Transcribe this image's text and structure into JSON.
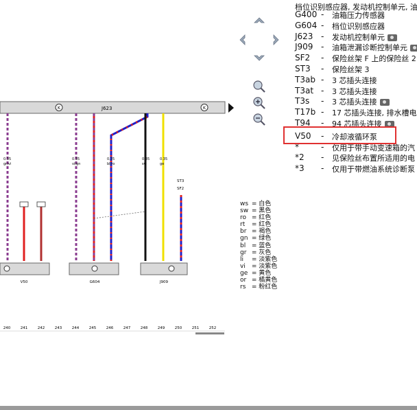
{
  "header_partial": "档位识别感应器, 发动机控制单元, 油",
  "components": [
    {
      "code": "G400",
      "desc": "油箱压力传感器",
      "cam": false
    },
    {
      "code": "G604",
      "desc": "档位识别感应器",
      "cam": false
    },
    {
      "code": "J623",
      "desc": "发动机控制单元",
      "cam": true
    },
    {
      "code": "J909",
      "desc": "油箱泄漏诊断控制单元",
      "cam": true
    },
    {
      "code": "SF2",
      "desc": "保险丝架 F 上的保险丝 2",
      "cam": false
    },
    {
      "code": "ST3",
      "desc": "保险丝架 3",
      "cam": false
    },
    {
      "code": "T3ab",
      "desc": "3 芯插头连接",
      "cam": false
    },
    {
      "code": "T3at",
      "desc": "3 芯插头连接",
      "cam": false
    },
    {
      "code": "T3s",
      "desc": "3 芯插头连接",
      "cam": true
    },
    {
      "code": "T17b",
      "desc": "17 芯插头连接, 排水槽电",
      "cam": false
    },
    {
      "code": "T94",
      "desc": "94 芯插头连接",
      "cam": true
    },
    {
      "code": "V50",
      "desc": "冷却液循环泵",
      "cam": false
    },
    {
      "code": "*",
      "desc": "仅用于带手动变速箱的汽",
      "cam": false
    },
    {
      "code": "*2",
      "desc": "见保险丝布置所适用的电",
      "cam": false
    },
    {
      "code": "*3",
      "desc": "仅用于带燃油系统诊断泵",
      "cam": false
    }
  ],
  "highlighted_code": "V50",
  "color_legend": [
    {
      "abbr": "ws",
      "name": "白色"
    },
    {
      "abbr": "sw",
      "name": "黑色"
    },
    {
      "abbr": "ro",
      "name": "红色"
    },
    {
      "abbr": "rt",
      "name": "红色"
    },
    {
      "abbr": "br",
      "name": "褐色"
    },
    {
      "abbr": "gn",
      "name": "绿色"
    },
    {
      "abbr": "bl",
      "name": "蓝色"
    },
    {
      "abbr": "gr",
      "name": "灰色"
    },
    {
      "abbr": "li",
      "name": "淡紫色"
    },
    {
      "abbr": "vi",
      "name": "淡紫色"
    },
    {
      "abbr": "ge",
      "name": "黄色"
    },
    {
      "abbr": "or",
      "name": "橘黄色"
    },
    {
      "abbr": "rs",
      "name": "粉红色"
    }
  ],
  "diagram": {
    "bus_label": "J623",
    "bus_marker": "K",
    "wire_sizes": [
      "0.35",
      "0.35",
      "0.35",
      "0.35",
      "0.35"
    ],
    "wire_colors": [
      "gr/vi",
      "vi/gn",
      "bl/ro",
      "sw",
      "ge"
    ],
    "components": {
      "left": "V50",
      "mid": "G604",
      "right": "J909"
    },
    "st_labels": [
      "ST3",
      "SF2"
    ],
    "column_numbers": [
      "240",
      "241",
      "242",
      "243",
      "244",
      "245",
      "246",
      "247",
      "248",
      "249",
      "250",
      "251",
      "252"
    ]
  },
  "colors": {
    "highlight": "#e03030",
    "wire_purple": "#8a3b8f",
    "wire_red": "#e02020",
    "wire_blue": "#2020c8",
    "wire_yellow": "#f0e000",
    "wire_black": "#111111",
    "bus_fill": "#d9d9d9"
  }
}
